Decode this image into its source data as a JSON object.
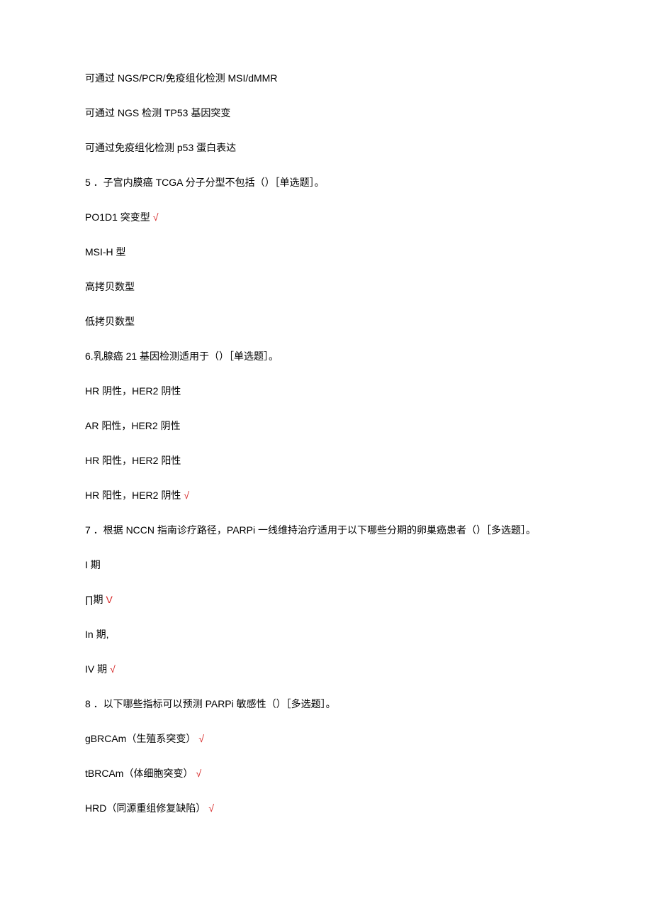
{
  "lines": [
    {
      "text": "可通过 NGS/PCR/免疫组化检测 MSI/dMMR",
      "check": false
    },
    {
      "text": "可通过 NGS 检测 TP53 基因突变",
      "check": false
    },
    {
      "text": "可通过免疫组化检测 p53 蛋白表达",
      "check": false
    },
    {
      "text": "5 ．子宫内膜癌 TCGA 分子分型不包括（）［单选题］。",
      "check": false
    },
    {
      "text": "PO1D1 突变型",
      "check": true,
      "checkSymbol": "√"
    },
    {
      "text": "MSI-H 型",
      "check": false
    },
    {
      "text": "高拷贝数型",
      "check": false
    },
    {
      "text": "低拷贝数型",
      "check": false
    },
    {
      "text": "6.乳腺癌 21 基因检测适用于（）［单选题］。",
      "check": false
    },
    {
      "text": "HR 阴性，HER2 阴性",
      "check": false
    },
    {
      "text": "AR 阳性，HER2 阴性",
      "check": false
    },
    {
      "text": "HR 阳性，HER2 阳性",
      "check": false
    },
    {
      "text": "HR 阳性，HER2 阴性",
      "check": true,
      "checkSymbol": "√"
    },
    {
      "text": "7 ．根据 NCCN 指南诊疗路径，PARPi 一线维持治疗适用于以下哪些分期的卵巢癌患者（）［多选题］。",
      "check": false
    },
    {
      "text": "I 期",
      "check": false
    },
    {
      "text": "∏期",
      "check": true,
      "checkSymbol": "V"
    },
    {
      "text": "In 期,",
      "check": false
    },
    {
      "text": "IV 期",
      "check": true,
      "checkSymbol": "√"
    },
    {
      "text": "8 ．以下哪些指标可以预测 PARPi 敏感性（）［多选题］。",
      "check": false
    },
    {
      "text": "gBRCAm（生殖系突变）",
      "check": true,
      "checkSymbol": "√"
    },
    {
      "text": "tBRCAm（体细胞突变）",
      "check": true,
      "checkSymbol": "√"
    },
    {
      "text": "HRD（同源重组修复缺陷）",
      "check": true,
      "checkSymbol": "√"
    }
  ]
}
